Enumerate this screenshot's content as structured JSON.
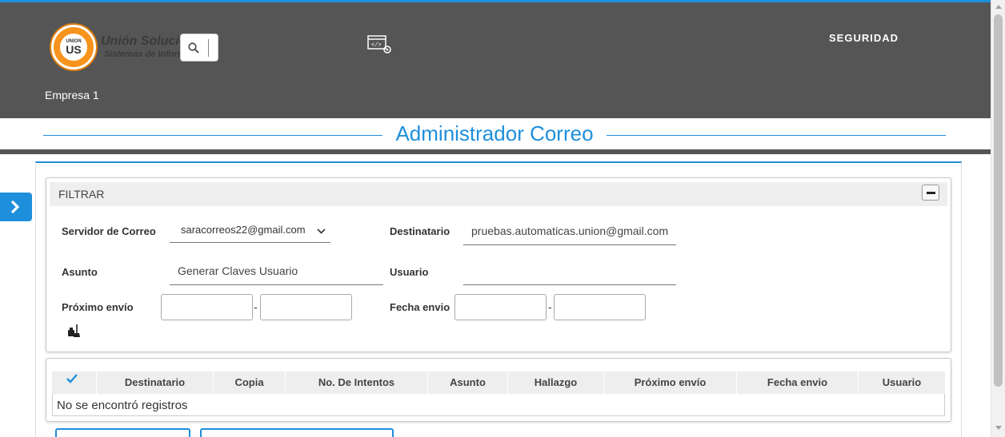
{
  "header": {
    "brand_name": "Unión Soluciones",
    "brand_subtitle": "Sistemas de Información",
    "logo_text_top": "UNION",
    "logo_text_main": "US",
    "module_label": "SEGURIDAD",
    "company": "Empresa 1"
  },
  "page": {
    "title": "Administrador Correo"
  },
  "filter": {
    "title": "FILTRAR",
    "mail_server_label": "Servidor de Correo",
    "mail_server_value": "saracorreos22@gmail.com",
    "recipient_label": "Destinatario",
    "recipient_value": "pruebas.automaticas.union@gmail.com",
    "subject_label": "Asunto",
    "subject_value": "Generar Claves Usuario",
    "user_label": "Usuario",
    "user_value": "",
    "next_send_label": "Próximo envío",
    "send_date_label": "Fecha envio",
    "range_separator": "-"
  },
  "table": {
    "columns": [
      "Destinatario",
      "Copia",
      "No. De Intentos",
      "Asunto",
      "Hallazgo",
      "Próximo envío",
      "Fecha envio",
      "Usuario"
    ],
    "empty_message": "No se encontró registros"
  },
  "colors": {
    "accent": "#1e8fdb",
    "header_bg": "#555555",
    "logo_orange": "#f7941d"
  }
}
